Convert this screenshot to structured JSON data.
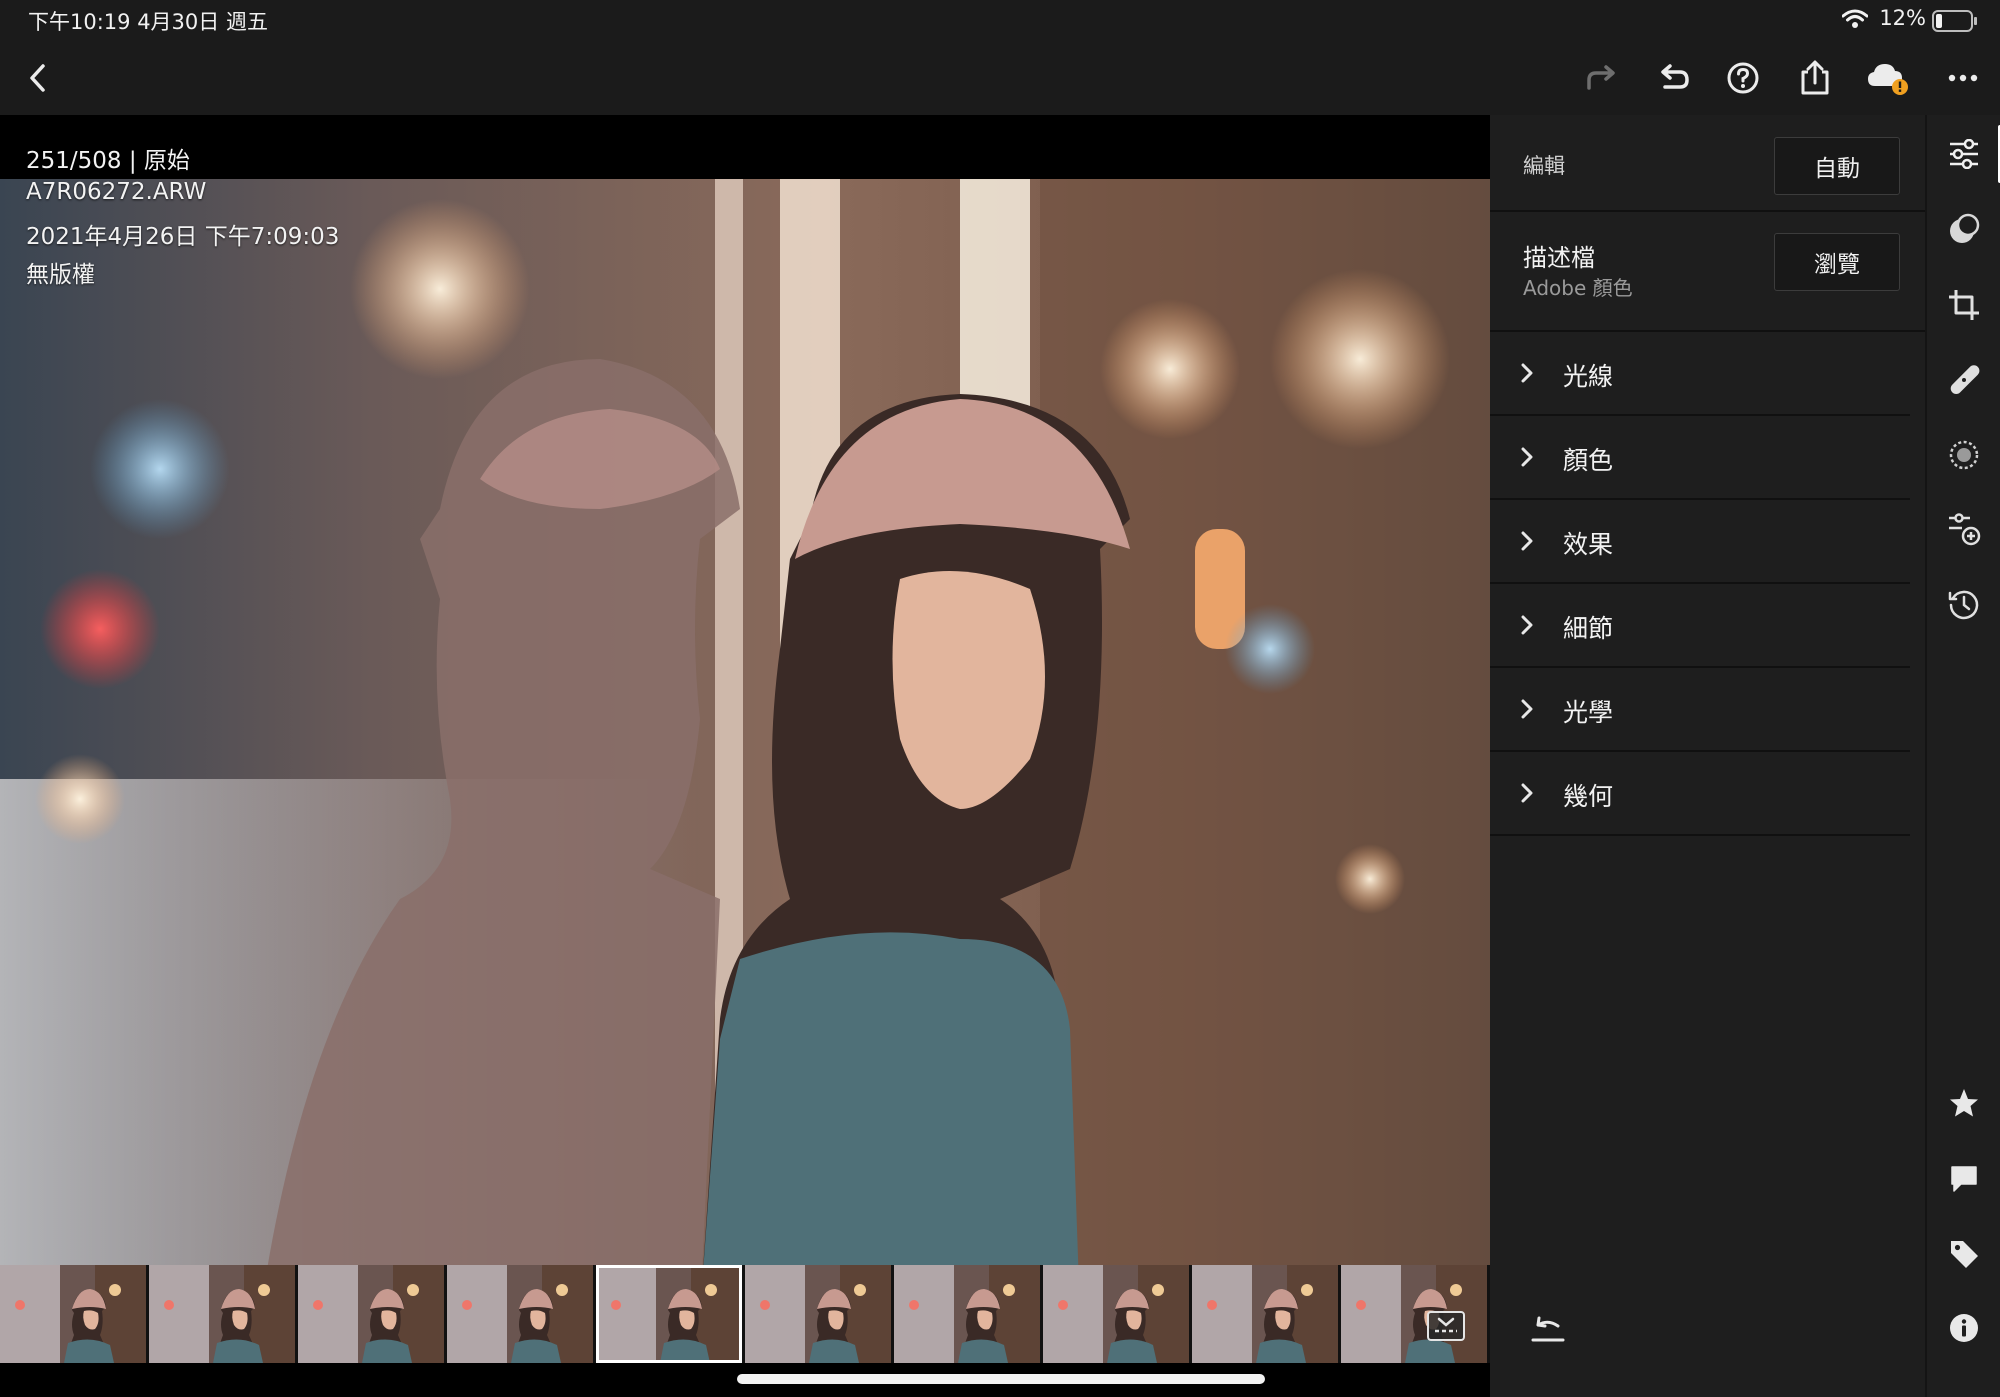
{
  "status_bar": {
    "time_date": "下午10:19   4月30日 週五",
    "battery": "12%"
  },
  "photo": {
    "meta": {
      "position": "251/508 | 原始",
      "filename": "A7R06272.ARW",
      "datetime": "2021年4月26日 下午7:09:03",
      "copyright": "無版權"
    }
  },
  "edit_panel": {
    "title": "編輯",
    "auto_label": "自動",
    "profile_title": "描述檔",
    "profile_value": "Adobe 顏色",
    "browse_label": "瀏覽",
    "sections": [
      "光線",
      "顏色",
      "效果",
      "細節",
      "光學",
      "幾何"
    ]
  },
  "toolbar_icons": [
    "back-icon",
    "redo-icon",
    "undo-icon",
    "help-icon",
    "share-icon",
    "cloud-sync-warning-icon",
    "more-icon"
  ],
  "rail_icons": [
    "edit-sliders-icon",
    "masking-icon",
    "crop-icon",
    "healing-icon",
    "selective-icon",
    "presets-icon",
    "history-icon",
    "star-icon",
    "comment-icon",
    "tag-icon",
    "info-icon"
  ],
  "accent": {
    "warning": "#f0a020",
    "selected_outline": "#ffffff"
  }
}
